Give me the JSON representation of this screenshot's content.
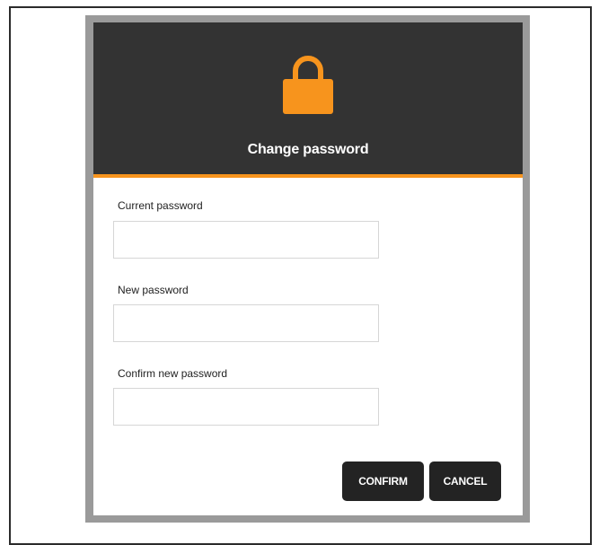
{
  "dialog": {
    "title": "Change password",
    "header_icon": "lock-icon",
    "fields": [
      {
        "label": "Current password",
        "value": "",
        "placeholder": ""
      },
      {
        "label": "New password",
        "value": "",
        "placeholder": ""
      },
      {
        "label": "Confirm new password",
        "value": "",
        "placeholder": ""
      }
    ],
    "buttons": {
      "confirm_label": "CONFIRM",
      "cancel_label": "CANCEL"
    }
  },
  "colors": {
    "header_background": "#333333",
    "accent": "#f7941d",
    "button_background": "#232323"
  }
}
